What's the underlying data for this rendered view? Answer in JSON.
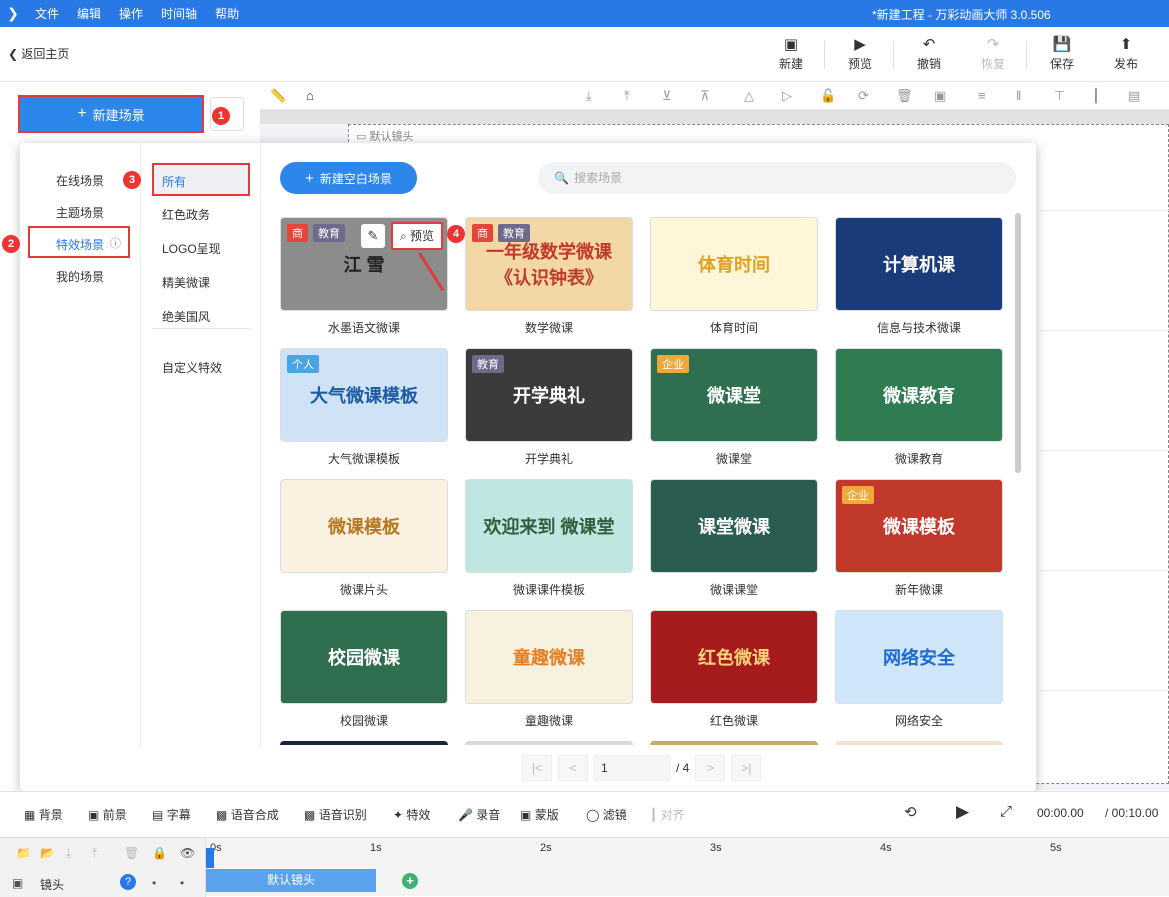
{
  "menubar": {
    "items": [
      "文件",
      "编辑",
      "操作",
      "时间轴",
      "帮助"
    ],
    "title": "*新建工程 - 万彩动画大师 3.0.506"
  },
  "toolbar": {
    "back": "返回主页",
    "buttons": [
      {
        "label": "新建",
        "icon": "plus-square-icon",
        "disabled": false
      },
      {
        "label": "预览",
        "icon": "play-icon",
        "disabled": false
      },
      {
        "label": "撤销",
        "icon": "undo-icon",
        "disabled": false
      },
      {
        "label": "恢复",
        "icon": "redo-icon",
        "disabled": true
      },
      {
        "label": "保存",
        "icon": "save-icon",
        "disabled": false
      },
      {
        "label": "发布",
        "icon": "publish-icon",
        "disabled": false
      }
    ]
  },
  "left": {
    "new_scene": "新建场景",
    "badge1": "1"
  },
  "canvas": {
    "default_lens": "默认镜头"
  },
  "popup": {
    "categories": [
      "在线场景",
      "主题场景",
      "特效场景",
      "我的场景"
    ],
    "selected_category": "特效场景",
    "subcategories": [
      "所有",
      "红色政务",
      "LOGO呈现",
      "精美微课",
      "绝美国风",
      "自定义特效"
    ],
    "badges": [
      "2",
      "3",
      "4"
    ],
    "new_blank": "新建空白场景",
    "search_placeholder": "搜索场景",
    "preview_label": "预览",
    "cards": [
      {
        "name": "水墨语文微课",
        "thumb": "江  雪",
        "tags": [
          "商",
          "教育"
        ],
        "bg": "#8c8c8c",
        "fg": "#222"
      },
      {
        "name": "数学微课",
        "thumb": "一年级数学微课 《认识钟表》",
        "tags": [
          "商",
          "教育"
        ],
        "bg": "#f4d7a6",
        "fg": "#c0392b"
      },
      {
        "name": "体育时间",
        "thumb": "体育时间",
        "tags": [],
        "bg": "#fdf6d8",
        "fg": "#e0a020"
      },
      {
        "name": "信息与技术微课",
        "thumb": "计算机课",
        "tags": [],
        "bg": "#1a3b7a",
        "fg": "#ffffff"
      },
      {
        "name": "大气微课模板",
        "thumb": "大气微课模板",
        "tags": [
          "个人"
        ],
        "bg": "#cfe2f6",
        "fg": "#1d5aa8"
      },
      {
        "name": "开学典礼",
        "thumb": "开学典礼",
        "tags": [
          "教育"
        ],
        "bg": "#3b3b3b",
        "fg": "#ffffff"
      },
      {
        "name": "微课堂",
        "thumb": "微课堂",
        "tags": [
          "企业"
        ],
        "bg": "#2f6e4e",
        "fg": "#ffffff"
      },
      {
        "name": "微课教育",
        "thumb": "微课教育",
        "tags": [],
        "bg": "#2f7b52",
        "fg": "#ffffff"
      },
      {
        "name": "微课片头",
        "thumb": "微课模板",
        "tags": [],
        "bg": "#fbf1e1",
        "fg": "#b7791f"
      },
      {
        "name": "微课课件模板",
        "thumb": "欢迎来到 微课堂",
        "tags": [],
        "bg": "#bfe6e0",
        "fg": "#2f5f3c"
      },
      {
        "name": "微课课堂",
        "thumb": "课堂微课",
        "tags": [],
        "bg": "#2b5c52",
        "fg": "#ffffff"
      },
      {
        "name": "新年微课",
        "thumb": "微课模板",
        "tags": [
          "企业"
        ],
        "bg": "#c0392b",
        "fg": "#ffffff"
      },
      {
        "name": "校园微课",
        "thumb": "校园微课",
        "tags": [],
        "bg": "#2f6e4e",
        "fg": "#ffffff"
      },
      {
        "name": "童趣微课",
        "thumb": "童趣微课",
        "tags": [],
        "bg": "#f7f1e0",
        "fg": "#e67e22"
      },
      {
        "name": "红色微课",
        "thumb": "红色微课",
        "tags": [],
        "bg": "#a61c1c",
        "fg": "#ffd27a"
      },
      {
        "name": "网络安全",
        "thumb": "网络安全",
        "tags": [],
        "bg": "#cfe6fb",
        "fg": "#1d6bd1"
      }
    ],
    "pager": {
      "first": "|<",
      "prev": "<",
      "page": "1",
      "total": "/ 4",
      "next": ">",
      "last": ">|"
    }
  },
  "bottom": {
    "items": [
      {
        "label": "背景",
        "icon": "background-icon"
      },
      {
        "label": "前景",
        "icon": "foreground-icon"
      },
      {
        "label": "字幕",
        "icon": "subtitle-icon"
      },
      {
        "label": "语音合成",
        "icon": "tts-icon"
      },
      {
        "label": "语音识别",
        "icon": "asr-icon"
      },
      {
        "label": "特效",
        "icon": "effect-icon"
      },
      {
        "label": "录音",
        "icon": "mic-icon"
      },
      {
        "label": "蒙版",
        "icon": "mask-icon"
      },
      {
        "label": "滤镜",
        "icon": "filter-icon"
      },
      {
        "label": "对齐",
        "icon": "align-icon"
      }
    ],
    "time_current": "00:00.00",
    "time_total": "/ 00:10.00"
  },
  "timeline": {
    "track_label": "镜头",
    "ticks": [
      "0s",
      "1s",
      "2s",
      "3s",
      "4s",
      "5s"
    ],
    "clip_label": "默认镜头"
  }
}
